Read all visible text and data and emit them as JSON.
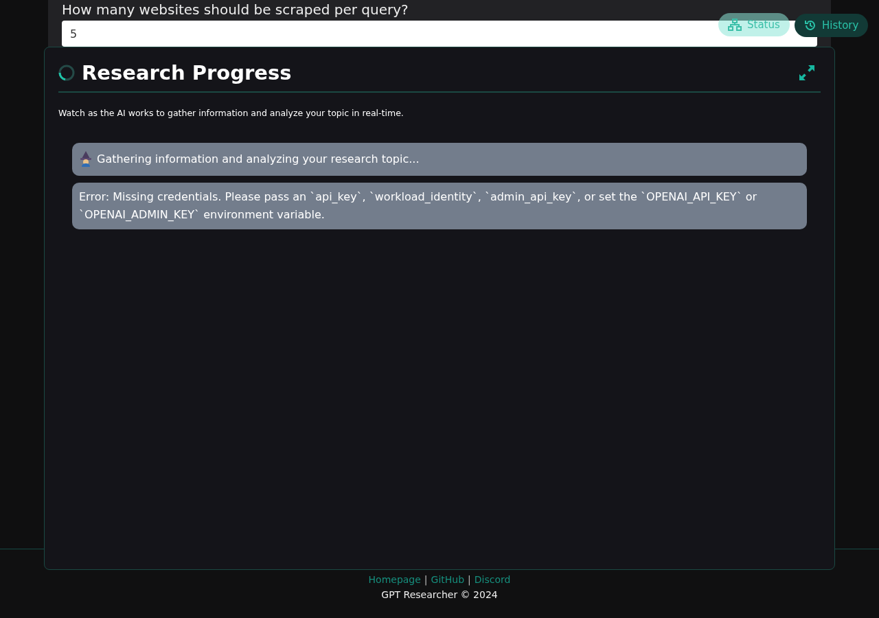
{
  "form": {
    "question": "How many websites should be scraped per query?",
    "value": "5"
  },
  "top_buttons": [
    {
      "label": "Status",
      "kind": "status"
    },
    {
      "label": "History",
      "kind": "history"
    }
  ],
  "progress": {
    "title": "Research Progress",
    "subtitle": "Watch as the AI works to gather information and analyze your topic in real-time.",
    "messages": [
      {
        "kind": "progress",
        "text": "Gathering information and analyzing your research topic..."
      },
      {
        "kind": "error",
        "text": "Error: Missing credentials. Please pass an `api_key`, `workload_identity`, `admin_api_key`, or set the `OPENAI_API_KEY` or `OPENAI_ADMIN_KEY` environment variable."
      }
    ]
  },
  "footer": {
    "links": [
      "Homepage",
      "GitHub",
      "Discord"
    ],
    "separators": [
      "|",
      "|"
    ],
    "copyright": "GPT Researcher © 2024"
  }
}
